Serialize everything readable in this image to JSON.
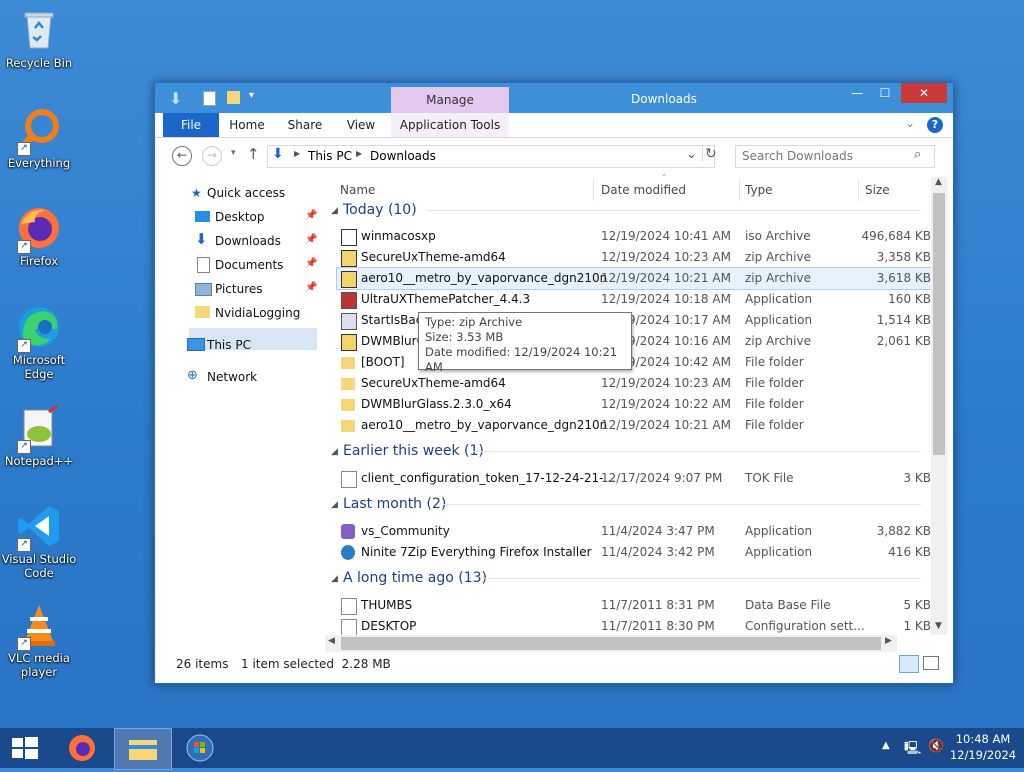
{
  "desktop": {
    "icons": [
      {
        "label": "Recycle Bin",
        "icon": "recycle-bin-icon"
      },
      {
        "label": "Everything",
        "icon": "everything-search-icon"
      },
      {
        "label": "Firefox",
        "icon": "firefox-icon"
      },
      {
        "label": "Microsoft Edge",
        "icon": "edge-icon"
      },
      {
        "label": "Notepad++",
        "icon": "notepadpp-icon"
      },
      {
        "label": "Visual Studio Code",
        "icon": "vscode-icon"
      },
      {
        "label": "VLC media player",
        "icon": "vlc-icon"
      }
    ]
  },
  "window": {
    "title": "Downloads",
    "manage_tab": "Manage",
    "ribbon_tabs": [
      "File",
      "Home",
      "Share",
      "View",
      "Application Tools"
    ],
    "breadcrumb": [
      "This PC",
      "Downloads"
    ],
    "search_placeholder": "Search Downloads"
  },
  "nav": {
    "quick_access": "Quick access",
    "items": [
      "Desktop",
      "Downloads",
      "Documents",
      "Pictures",
      "NvidiaLogging"
    ],
    "this_pc": "This PC",
    "network": "Network"
  },
  "columns": {
    "name": "Name",
    "date": "Date modified",
    "type": "Type",
    "size": "Size"
  },
  "groups": {
    "today": "Today (10)",
    "earlier": "Earlier this week (1)",
    "last_month": "Last month (2)",
    "long_ago": "A long time ago (13)"
  },
  "files": {
    "today": [
      {
        "name": "winmacosxp",
        "date": "12/19/2024 10:41 AM",
        "type": "iso Archive",
        "size": "496,684 KB",
        "icon": "iso-icon"
      },
      {
        "name": "SecureUxTheme-amd64",
        "date": "12/19/2024 10:23 AM",
        "type": "zip Archive",
        "size": "3,358 KB",
        "icon": "zip-icon"
      },
      {
        "name": "aero10__metro_by_vaporvance_dgn210n",
        "date": "12/19/2024 10:21 AM",
        "type": "zip Archive",
        "size": "3,618 KB",
        "icon": "zip-icon"
      },
      {
        "name": "UltraUXThemePatcher_4.4.3",
        "date": "12/19/2024 10:18 AM",
        "type": "Application",
        "size": "160 KB",
        "icon": "app-icon"
      },
      {
        "name": "StartIsBack",
        "date": "12/19/2024 10:17 AM",
        "type": "Application",
        "size": "1,514 KB",
        "icon": "app-icon"
      },
      {
        "name": "DWMBlurG",
        "date": "12/19/2024 10:16 AM",
        "type": "zip Archive",
        "size": "2,061 KB",
        "icon": "zip-icon"
      },
      {
        "name": "[BOOT]",
        "date": "12/19/2024 10:42 AM",
        "type": "File folder",
        "size": "",
        "icon": "folder-icon"
      },
      {
        "name": "SecureUxTheme-amd64",
        "date": "12/19/2024 10:23 AM",
        "type": "File folder",
        "size": "",
        "icon": "folder-icon"
      },
      {
        "name": "DWMBlurGlass.2.3.0_x64",
        "date": "12/19/2024 10:22 AM",
        "type": "File folder",
        "size": "",
        "icon": "folder-icon"
      },
      {
        "name": "aero10__metro_by_vaporvance_dgn210n",
        "date": "12/19/2024 10:21 AM",
        "type": "File folder",
        "size": "",
        "icon": "folder-icon"
      }
    ],
    "earlier": [
      {
        "name": "client_configuration_token_17-12-24-21-...",
        "date": "12/17/2024 9:07 PM",
        "type": "TOK File",
        "size": "3 KB",
        "icon": "file-icon"
      }
    ],
    "last_month": [
      {
        "name": "vs_Community",
        "date": "11/4/2024 3:47 PM",
        "type": "Application",
        "size": "3,882 KB",
        "icon": "vs-icon"
      },
      {
        "name": "Ninite 7Zip Everything Firefox Installer",
        "date": "11/4/2024 3:42 PM",
        "type": "Application",
        "size": "416 KB",
        "icon": "ninite-icon"
      }
    ],
    "long_ago": [
      {
        "name": "THUMBS",
        "date": "11/7/2011 8:31 PM",
        "type": "Data Base File",
        "size": "5 KB",
        "icon": "db-icon"
      },
      {
        "name": "DESKTOP",
        "date": "11/7/2011 8:30 PM",
        "type": "Configuration sett...",
        "size": "1 KB",
        "icon": "config-icon"
      }
    ]
  },
  "tooltip": {
    "type": "Type: zip Archive",
    "size": "Size: 3.53 MB",
    "date": "Date modified: 12/19/2024 10:21 AM"
  },
  "status": {
    "count": "26 items",
    "selected": "1 item selected  2.28 MB"
  },
  "taskbar": {
    "time": "10:48 AM",
    "date": "12/19/2024"
  }
}
